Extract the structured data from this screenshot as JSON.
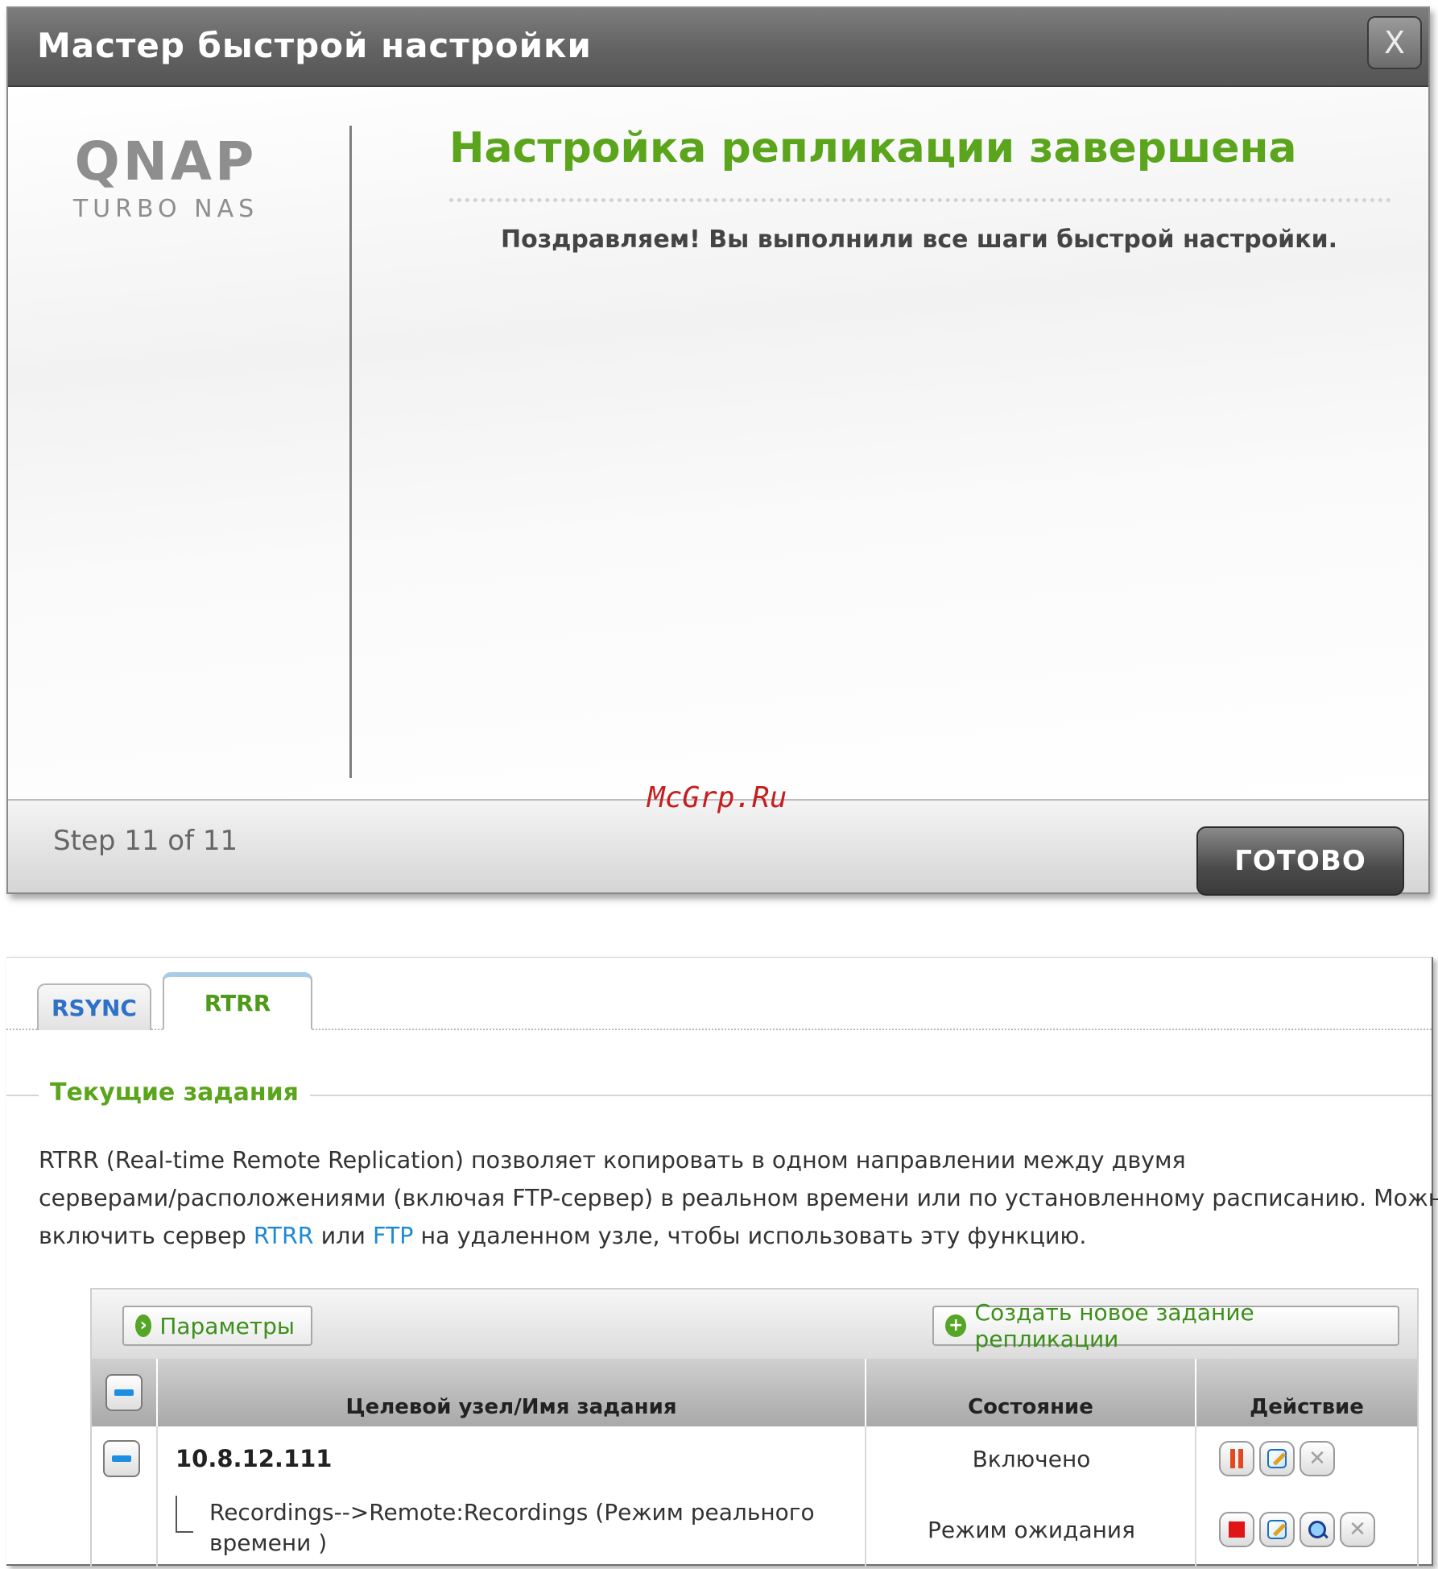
{
  "wizard": {
    "title": "Мастер быстрой настройки",
    "close_label": "X",
    "logo": {
      "main": "QNAP",
      "sub": "TURBO NAS"
    },
    "headline": "Настройка репликации завершена",
    "message": "Поздравляем! Вы выполнили все шаги быстрой настройки.",
    "step": "Step 11 of 11",
    "watermark": "McGrp.Ru",
    "done_label": "ГОТОВО"
  },
  "replication": {
    "tabs": [
      {
        "label": "RSYNC",
        "active": false
      },
      {
        "label": "RTRR",
        "active": true
      }
    ],
    "section_title": "Текущие задания",
    "description": {
      "line1": "RTRR (Real-time Remote Replication) позволяет копировать в одном направлении между двумя",
      "line2": "серверами/расположениями (включая FTP-сервер) в реальном времени или по установленному расписанию. Можно",
      "line3_pre": "включить сервер ",
      "link1": "RTRR",
      "line3_mid": " или ",
      "link2": "FTP",
      "line3_post": " на удаленном узле, чтобы использовать эту функцию."
    },
    "toolbar": {
      "params_label": "Параметры",
      "create_label": "Создать новое задание репликации"
    },
    "table": {
      "columns": [
        "Целевой узел/Имя задания",
        "Состояние",
        "Действие"
      ],
      "host": {
        "name": "10.8.12.111",
        "state": "Включено"
      },
      "job": {
        "name": "Recordings-->Remote:Recordings (Режим реального времени )",
        "state": "Режим ожидания"
      }
    }
  }
}
